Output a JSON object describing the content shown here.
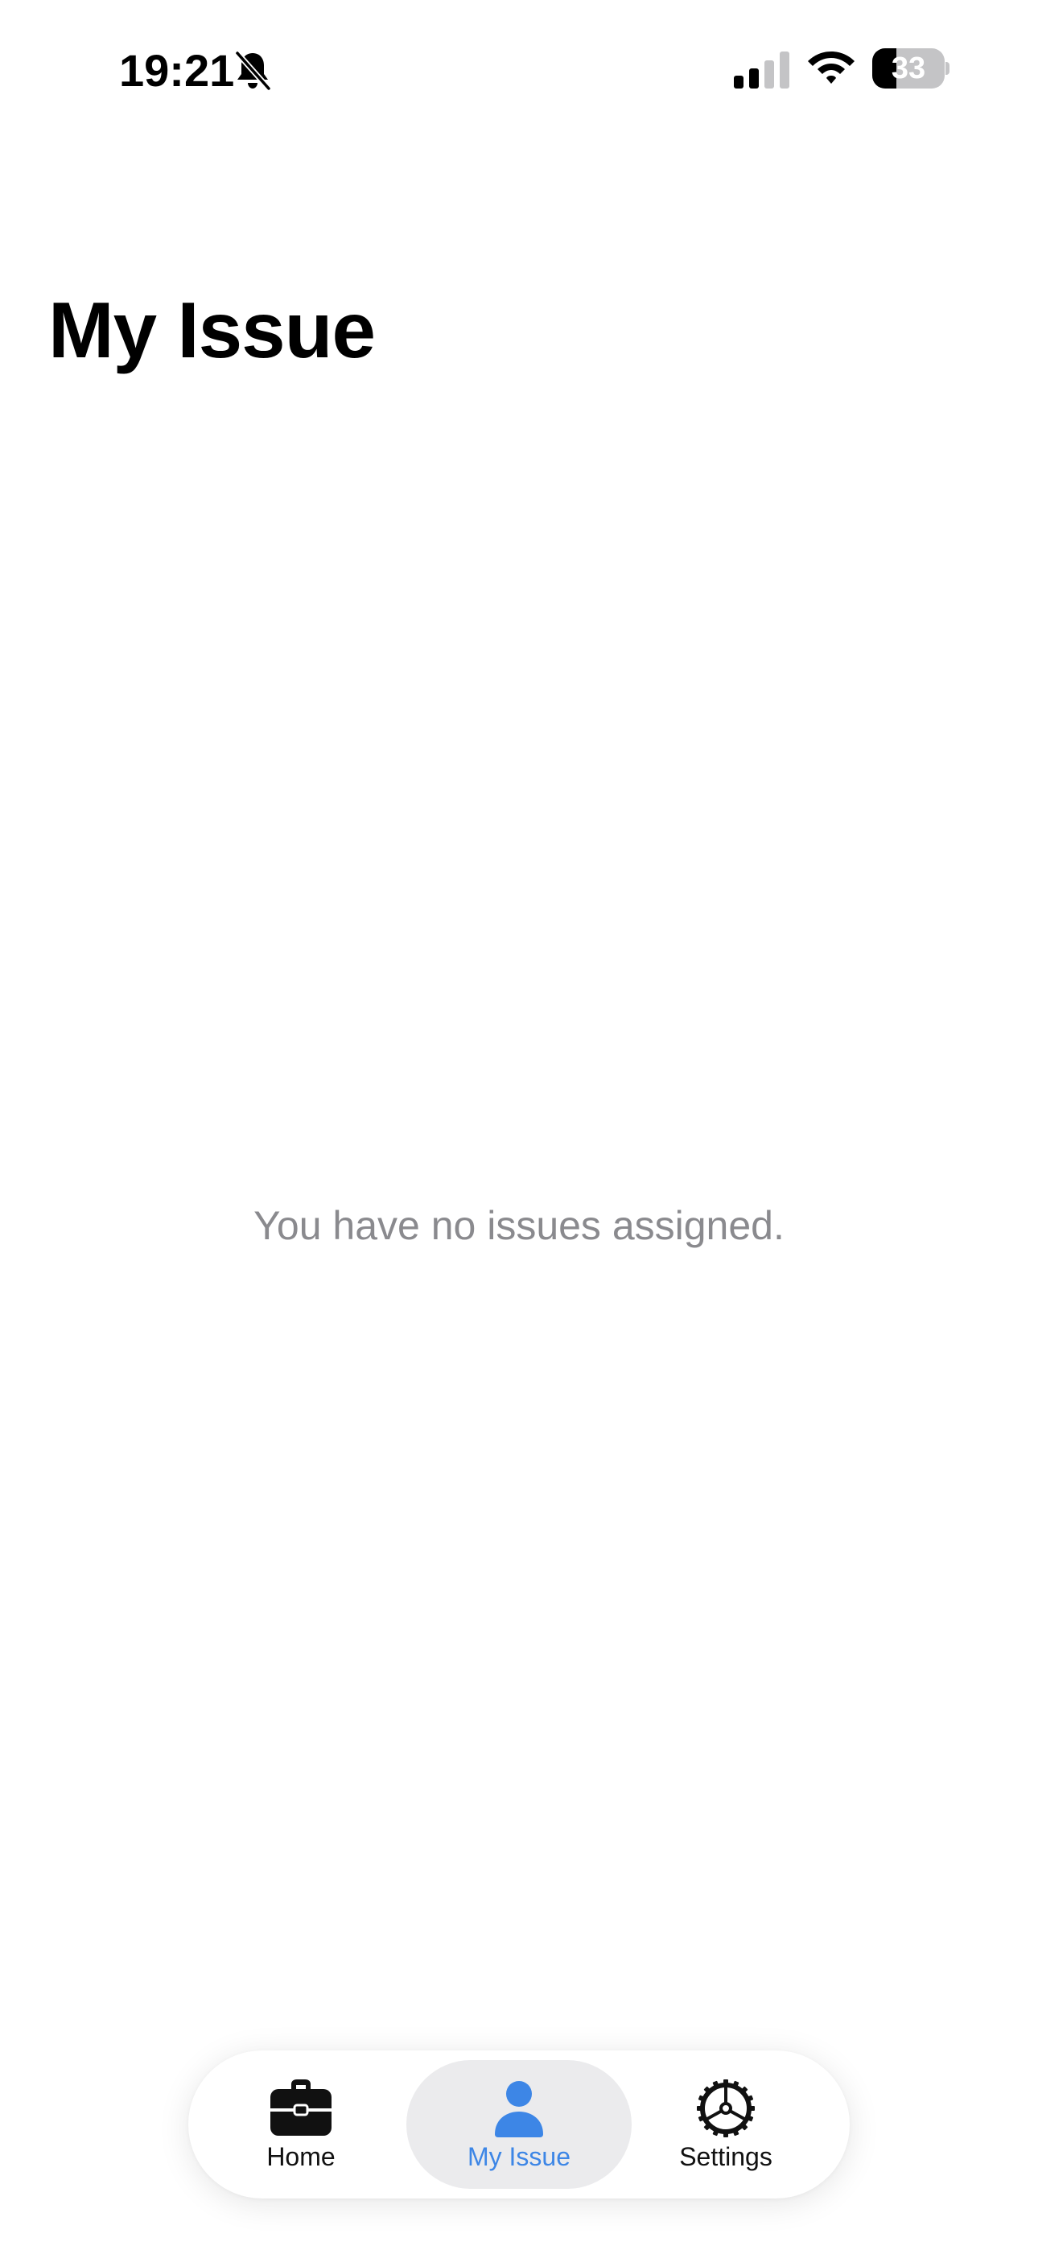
{
  "status_bar": {
    "time": "19:21",
    "battery_level": "33",
    "battery_fraction": 0.33,
    "signal_bars_active": 2,
    "signal_bars_total": 4,
    "icons": [
      "bell-slash-icon",
      "cellular-signal-icon",
      "wifi-icon",
      "battery-icon"
    ]
  },
  "header": {
    "title": "My Issue"
  },
  "main": {
    "empty_message": "You have no issues assigned."
  },
  "tab_bar": {
    "accent_color": "#3d86e6",
    "tabs": [
      {
        "label": "Home",
        "icon": "briefcase-icon",
        "selected": false
      },
      {
        "label": "My Issue",
        "icon": "person-icon",
        "selected": true
      },
      {
        "label": "Settings",
        "icon": "gear-icon",
        "selected": false
      }
    ]
  }
}
